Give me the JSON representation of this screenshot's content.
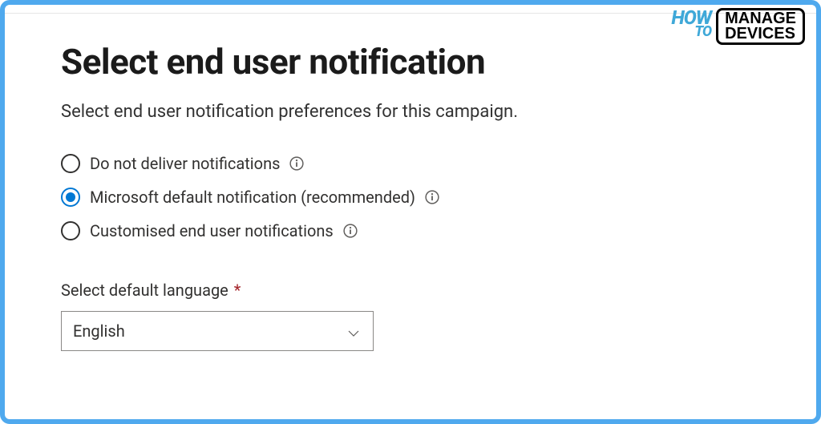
{
  "header": {
    "title": "Select end user notification",
    "description": "Select end user notification preferences for this campaign."
  },
  "radios": [
    {
      "label": "Do not deliver notifications",
      "selected": false
    },
    {
      "label": "Microsoft default notification (recommended)",
      "selected": true
    },
    {
      "label": "Customised end user notifications",
      "selected": false
    }
  ],
  "language": {
    "label": "Select default language",
    "required_marker": "*",
    "value": "English"
  },
  "brand": {
    "how": "HOW",
    "to": "TO",
    "line1": "MANAGE",
    "line2": "DEVICES"
  }
}
